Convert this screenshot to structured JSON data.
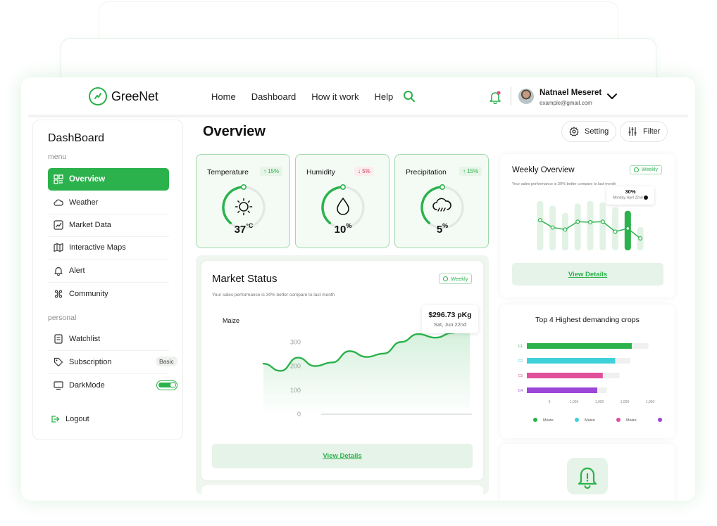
{
  "brand": {
    "name": "GreeNet",
    "accent": "#2bb24c",
    "light_accent": "#e6f3e8",
    "alert_pink": "#d0405e"
  },
  "nav": {
    "items": [
      "Home",
      "Dashboard",
      "How it work",
      "Help"
    ]
  },
  "user": {
    "name": "Natnael Meseret",
    "email": "example@gmail.com"
  },
  "sidebar": {
    "title": "DashBoard",
    "menu_label": "menu",
    "personal_label": "personal",
    "items": [
      {
        "label": "Overview",
        "icon": "grid-icon"
      },
      {
        "label": "Weather",
        "icon": "cloud-icon"
      },
      {
        "label": "Market Data",
        "icon": "chart-icon"
      },
      {
        "label": "Interactive Maps",
        "icon": "map-icon"
      },
      {
        "label": "Alert",
        "icon": "bell-icon"
      },
      {
        "label": "Community",
        "icon": "community-icon"
      }
    ],
    "personal_items": [
      {
        "label": "Watchlist",
        "icon": "list-icon"
      },
      {
        "label": "Subscription",
        "icon": "tag-icon",
        "badge": "Basic"
      },
      {
        "label": "DarkMode",
        "icon": "monitor-icon",
        "toggle": true
      }
    ],
    "logout": "Logout"
  },
  "page": {
    "title": "Overview",
    "setting_label": "Setting",
    "filter_label": "Filter"
  },
  "stats": [
    {
      "label": "Temperature",
      "change": "15%",
      "direction": "up",
      "value": "37",
      "unit": "°C",
      "level": 0.5
    },
    {
      "label": "Humidity",
      "change": "5%",
      "direction": "down",
      "value": "10",
      "unit": "%",
      "level": 0.5
    },
    {
      "label": "Precipitation",
      "change": "15%",
      "direction": "up",
      "value": "5",
      "unit": "%",
      "level": 0.5
    }
  ],
  "market": {
    "title": "Market Status",
    "chip": "Weekly",
    "subtitle": "Your sales performance is 30% better compare to last month",
    "series_label": "Maize",
    "tooltip_price": "$296.73 pKg",
    "tooltip_date": "Sat, Jun 22nd",
    "view_details": "View Details",
    "chart_data": {
      "type": "area",
      "series_name": "Maize",
      "yticks": [
        0,
        100,
        200,
        300
      ],
      "ylim": [
        0,
        380
      ],
      "x": [
        0,
        1,
        2,
        3,
        4,
        5,
        6,
        7,
        8,
        9,
        10,
        11,
        12
      ],
      "values": [
        210,
        180,
        235,
        200,
        215,
        262,
        238,
        252,
        300,
        333,
        318,
        338,
        380
      ]
    }
  },
  "weekly": {
    "title": "Weekly Overview",
    "chip": "Weekly",
    "subtitle": "Your sales performance is 30% better compare to last month",
    "tooltip_value": "30%",
    "tooltip_date": "Monday, April 22nd",
    "view_details": "View Details",
    "chart_data": {
      "type": "bar",
      "bars": [
        0.95,
        0.86,
        0.72,
        0.9,
        0.95,
        0.92,
        0.83,
        0.76,
        0.45
      ],
      "line": [
        0.58,
        0.44,
        0.4,
        0.55,
        0.54,
        0.55,
        0.36,
        0.42,
        0.23
      ],
      "highlight_index": 7
    }
  },
  "crops": {
    "title": "Top 4 Highest demanding crops",
    "chart_data": {
      "type": "bar",
      "orientation": "horizontal",
      "categories": [
        "C1",
        "C2",
        "C3",
        "C4"
      ],
      "values": [
        0.76,
        0.64,
        0.55,
        0.51
      ],
      "totals": [
        0.88,
        0.75,
        0.67,
        0.58
      ],
      "colors": [
        "#2bb24c",
        "#3ed0d8",
        "#e0509a",
        "#9b45d9"
      ],
      "xtick_labels": [
        "0",
        "1,000",
        "1,000",
        "1,000",
        "1,000",
        "1,000"
      ],
      "legend": [
        "Maize",
        "Maize",
        "Maize",
        "Maize"
      ]
    }
  }
}
